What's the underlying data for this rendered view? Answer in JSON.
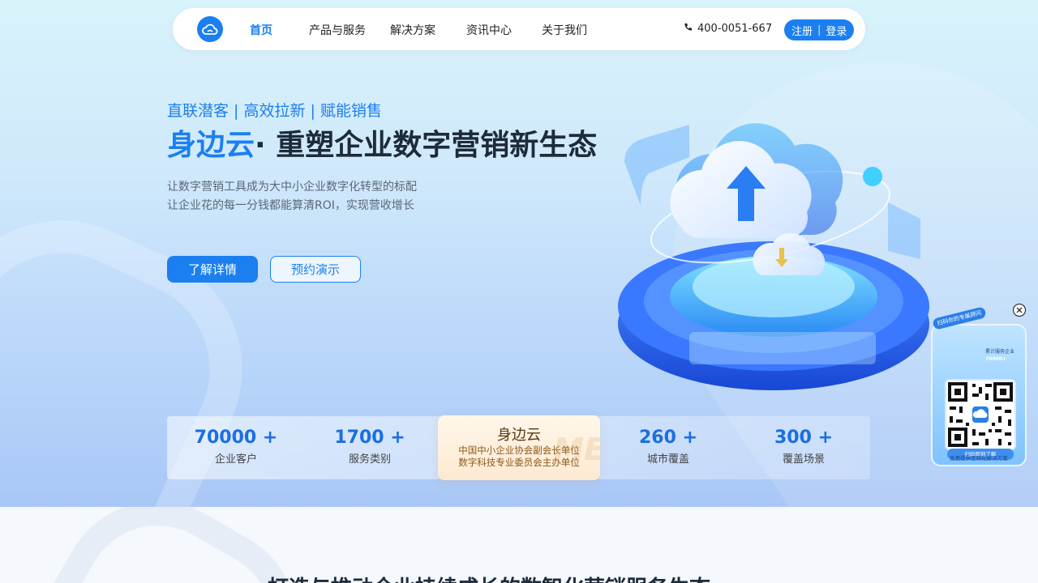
{
  "nav": {
    "items": [
      {
        "label": "首页",
        "active": true
      },
      {
        "label": "产品与服务",
        "active": false
      },
      {
        "label": "解决方案",
        "active": false
      },
      {
        "label": "资讯中心",
        "active": false
      },
      {
        "label": "关于我们",
        "active": false
      }
    ],
    "phone": "400-0051-667",
    "register": "注册",
    "login": "登录"
  },
  "hero": {
    "tagline": "直联潜客 | 高效拉新 | 赋能销售",
    "brand": "身边云",
    "headline_rest": "· 重塑企业数字营销新生态",
    "desc_line1": "让数字营销工具成为大中小企业数字化转型的标配",
    "desc_line2": "让企业花的每一分钱都能算清ROI，实现营收增长",
    "btn_primary": "了解详情",
    "btn_secondary": "预约演示"
  },
  "stats": [
    {
      "num": "70000 +",
      "label": "企业客户"
    },
    {
      "num": "1700 +",
      "label": "服务类别"
    },
    {
      "num": "260 +",
      "label": "城市覆盖"
    },
    {
      "num": "300 +",
      "label": "覆盖场景"
    }
  ],
  "stat_center": {
    "title": "身边云",
    "line1": "中国中小企业协会副会长单位",
    "line2": "数字科技专业委员会主办单位"
  },
  "widget": {
    "badge": "扫码你的专属顾问",
    "side_label": "累计服务企业",
    "side_value": "70000+",
    "scan": "扫码即刻了解",
    "footer": "免费提供定制化解决方案"
  },
  "colors": {
    "brand": "#1b7ff0"
  },
  "bottom": {
    "title": "打造与推动企业持续成长的数智化营销服务生态"
  }
}
